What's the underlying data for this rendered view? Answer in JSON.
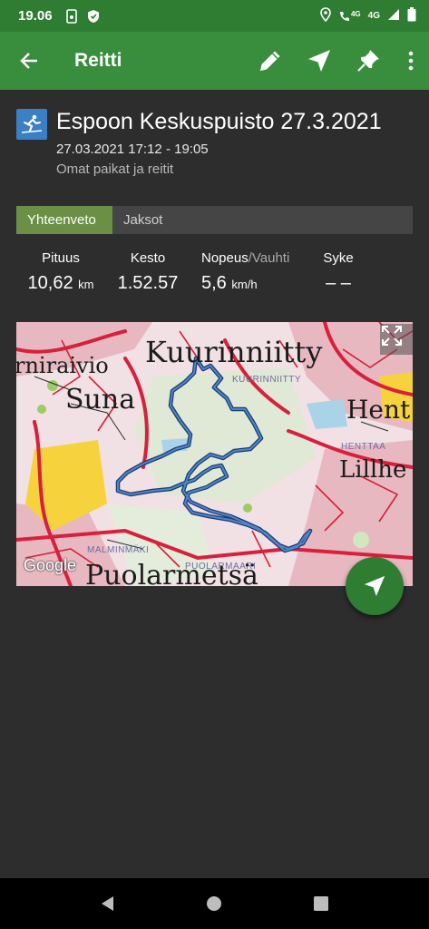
{
  "status_bar": {
    "time": "19.06",
    "network_label": "4G",
    "network_label2": "4G",
    "icons": [
      "screenshot-icon",
      "shield-icon",
      "location-icon",
      "wifi-call-icon",
      "signal-icon",
      "battery-icon"
    ]
  },
  "app_bar": {
    "title": "Reitti",
    "icons": [
      "back-arrow-icon",
      "pencil-icon",
      "navigate-icon",
      "pin-icon",
      "more-vert-icon"
    ]
  },
  "route": {
    "title": "Espoon Keskuspuisto 27.3.2021",
    "date_time": "27.03.2021 17:12 - 19:05",
    "category": "Omat paikat ja reitit",
    "sport_icon": "cross-country-skiing-icon"
  },
  "tabs": [
    {
      "label": "Yhteenveto",
      "active": true
    },
    {
      "label": "Jaksot",
      "active": false
    }
  ],
  "stats": {
    "distance": {
      "label": "Pituus",
      "value": "10,62",
      "unit": "km"
    },
    "duration": {
      "label": "Kesto",
      "value": "1.52.57"
    },
    "speed": {
      "label": "Nopeus",
      "label_alt": "/Vauhti",
      "value": "5,6",
      "unit": "km/h"
    },
    "heart_rate": {
      "label": "Syke",
      "value": "– –"
    }
  },
  "map": {
    "places": {
      "kuurinniitty": "Kuurinniitty",
      "kuurinniitty_small": "KUURINNIITTY",
      "rniraivio": "rniraivio",
      "suna": "Suna",
      "hent": "Hent",
      "henttaa_small": "HENTTAA",
      "lillhe": "Lillhe",
      "malminmaki_small": "MALMINMÄKI",
      "puolarmaari_small": "PUOLARMAARI",
      "puolarmetsa": "Puolarmetsä"
    },
    "attribution": "Google",
    "route_color": "#3f6fae"
  },
  "colors": {
    "accent": "#388e3c",
    "status_bar": "#2e7d32",
    "background": "#2d2d2d",
    "active_tab": "#6a8f45"
  }
}
